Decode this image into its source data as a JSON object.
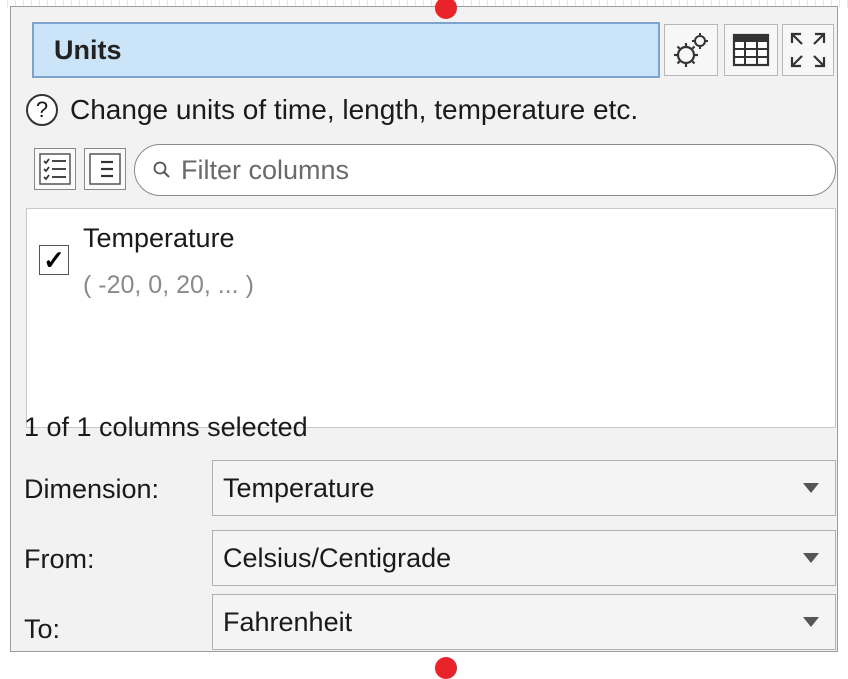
{
  "title": "Units",
  "help_text": "Change units of time, length, temperature etc.",
  "filter": {
    "placeholder": "Filter columns"
  },
  "columns": [
    {
      "name": "Temperature",
      "sample": "( -20, 0, 20, ... )",
      "checked": true
    }
  ],
  "status": "1 of 1 columns selected",
  "form": {
    "dimension": {
      "label": "Dimension:",
      "value": "Temperature"
    },
    "from": {
      "label": "From:",
      "value": "Celsius/Centigrade"
    },
    "to": {
      "label": "To:",
      "value": "Fahrenheit"
    }
  },
  "icons": {
    "options": "gear-icon",
    "table": "table-icon",
    "expand": "expand-icon",
    "help": "help-icon",
    "select_all": "checklist-icon",
    "select_none": "list-icon",
    "search": "search-icon",
    "check": "checkmark-icon",
    "dropdown": "chevron-down-icon"
  },
  "colors": {
    "title_bg": "#cce4f7",
    "title_border": "#7da2ce",
    "connector": "#e8232a",
    "panel_bg": "#f2f2f2"
  }
}
